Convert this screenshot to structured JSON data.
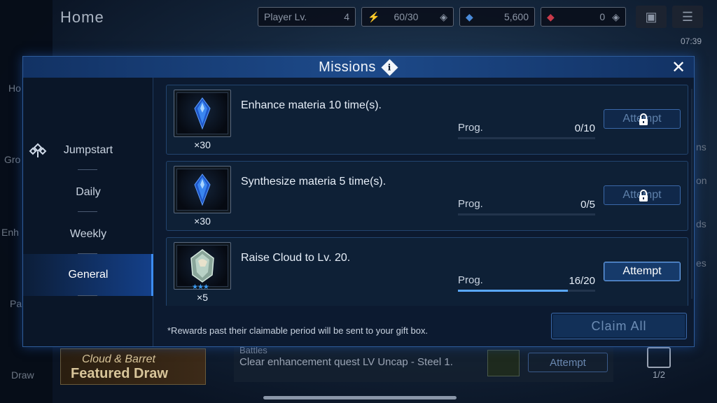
{
  "header": {
    "title": "Home",
    "player_label": "Player Lv.",
    "player_level": "4",
    "stamina": "60/30",
    "gems": "5,600",
    "red_crystals": "0",
    "clock": "07:39"
  },
  "sidebar_fragments": [
    "Ho",
    "Gro",
    "Enh",
    "Pa",
    "Draw"
  ],
  "right_fragments": [
    "ns",
    "on",
    "ds",
    "es"
  ],
  "background": {
    "banner_line1": "Cloud & Barret",
    "banner_line2": "Featured Draw",
    "quest_category": "Battles",
    "quest_text": "Clear enhancement quest LV Uncap - Steel 1.",
    "quest_attempt": "Attempt",
    "gift_count": "1/2"
  },
  "modal": {
    "title": "Missions",
    "info_glyph": "i",
    "close_glyph": "✕",
    "tabs": [
      {
        "label": "Jumpstart",
        "active": false
      },
      {
        "label": "Daily",
        "active": false
      },
      {
        "label": "Weekly",
        "active": false
      },
      {
        "label": "General",
        "active": true
      }
    ],
    "missions": [
      {
        "description": "Enhance materia 10 time(s).",
        "reward_qty": "×30",
        "progress_label": "Prog.",
        "progress_text": "0/10",
        "progress": 0.0,
        "button": "Attempt",
        "locked": true,
        "reward_icon": "materia-crystal-icon"
      },
      {
        "description": "Synthesize materia 5 time(s).",
        "reward_qty": "×30",
        "progress_label": "Prog.",
        "progress_text": "0/5",
        "progress": 0.0,
        "button": "Attempt",
        "locked": true,
        "reward_icon": "materia-crystal-icon"
      },
      {
        "description": "Raise Cloud to Lv. 20.",
        "reward_qty": "×5",
        "progress_label": "Prog.",
        "progress_text": "16/20",
        "progress": 0.8,
        "button": "Attempt",
        "locked": false,
        "reward_icon": "cloud-memory-crystal-icon",
        "stars": "★★★"
      }
    ],
    "footer_note": "*Rewards past their claimable period will be sent to your gift box.",
    "claim_all": "Claim All"
  },
  "colors": {
    "accent": "#3c8cf0",
    "panel": "#0c1a30",
    "progress_fill": "#5aa8ff"
  }
}
